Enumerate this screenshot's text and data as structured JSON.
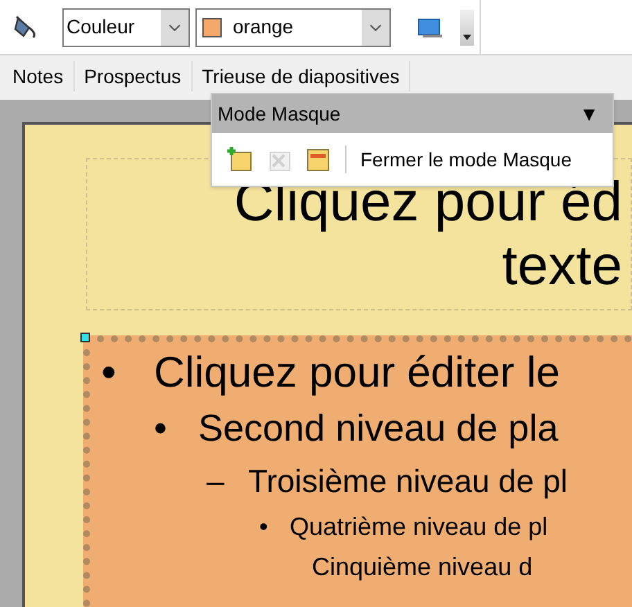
{
  "toolbar": {
    "fill_mode": "Couleur",
    "fill_color": {
      "label": "orange",
      "color": "#f4a86a"
    }
  },
  "view_tabs": [
    {
      "label": "Notes"
    },
    {
      "label": "Prospectus"
    },
    {
      "label": "Trieuse de diapositives"
    }
  ],
  "popup": {
    "title": "Mode Masque",
    "expand_glyph": "▼",
    "close_label": "Fermer le mode Masque"
  },
  "slide": {
    "title_lines": [
      "Cliquez pour éd",
      "texte"
    ],
    "body": [
      {
        "bullet": "•",
        "text": "Cliquez pour éditer le",
        "children": [
          {
            "bullet": "•",
            "text": "Second niveau de pla",
            "children": [
              {
                "bullet": "–",
                "text": "Troisième niveau de pl",
                "children": [
                  {
                    "bullet": "•",
                    "text": "Quatrième niveau de pl",
                    "children": [
                      {
                        "text": "Cinquième niveau d"
                      }
                    ]
                  }
                ]
              }
            ]
          }
        ]
      }
    ]
  }
}
